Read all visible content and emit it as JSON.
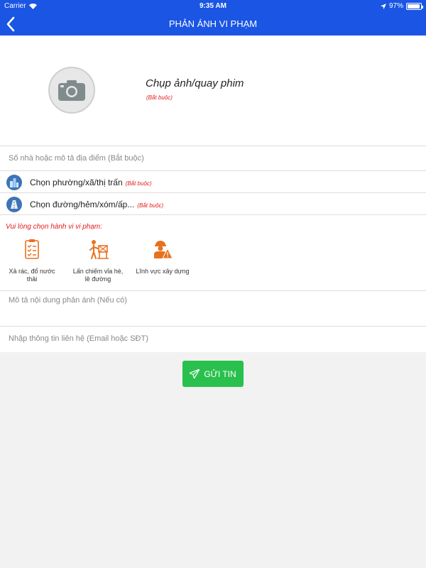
{
  "status_bar": {
    "carrier": "Carrier",
    "time": "9:35 AM",
    "battery": "97%",
    "battery_level": 0.97
  },
  "nav": {
    "title": "PHẢN ÁNH VI PHẠM",
    "back_icon": "chevron-left-icon"
  },
  "photo": {
    "label": "Chụp ảnh/quay phim",
    "required": "(Bắt buộc)",
    "icon": "camera-icon"
  },
  "address": {
    "placeholder": "Số nhà hoặc mô tả địa điểm (Bắt buộc)"
  },
  "ward": {
    "label": "Chọn phường/xã/thị trấn",
    "required": "(Bắt buộc)",
    "icon": "buildings-icon"
  },
  "street": {
    "label": "Chọn đường/hẻm/xóm/ấp...",
    "required": "(Bắt buộc)",
    "icon": "road-icon"
  },
  "violation": {
    "title": "Vui lòng chọn hành vi vi phạm:",
    "types": [
      {
        "label": "Xả rác, đổ nước thải",
        "icon": "checklist-icon"
      },
      {
        "label": "Lấn chiếm vỉa hè, lề đường",
        "icon": "sidewalk-encroachment-icon"
      },
      {
        "label": "Lĩnh vực xây dựng",
        "icon": "construction-worker-icon"
      }
    ]
  },
  "description": {
    "placeholder": "Mô tả nội dung phản ánh (Nếu có)"
  },
  "contact": {
    "placeholder": "Nhập thông tin liên hệ (Email hoặc SĐT)"
  },
  "submit": {
    "label": "GỬI TIN",
    "icon": "paper-plane-icon"
  },
  "colors": {
    "primary": "#1a55e3",
    "required_red": "#e21b1b",
    "submit_green": "#2ac04d",
    "icon_orange": "#e8711e"
  }
}
